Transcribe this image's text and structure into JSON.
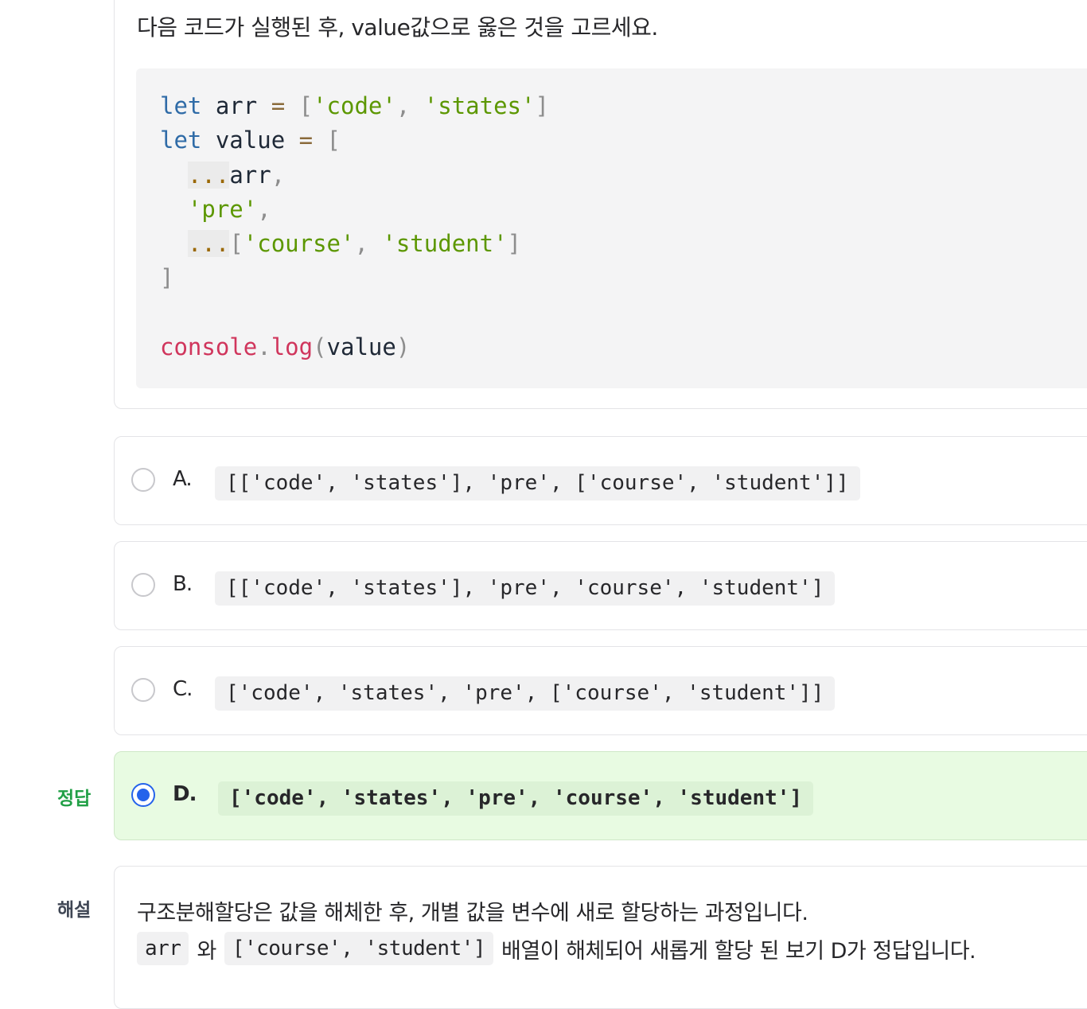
{
  "question": {
    "text": "다음 코드가 실행된 후, value값으로 옳은 것을 고르세요.",
    "code": {
      "line1": {
        "kw": "let",
        "name": " arr ",
        "op": "=",
        "open": " [",
        "s1": "'code'",
        "comma1": ", ",
        "s2": "'states'",
        "close": "]"
      },
      "line2": {
        "kw": "let",
        "name": " value ",
        "op": "=",
        "open": " ["
      },
      "line3": {
        "spread": "...",
        "name": "arr",
        "comma": ","
      },
      "line4": {
        "str": "'pre'",
        "comma": ","
      },
      "line5": {
        "spread": "...",
        "open": "[",
        "s1": "'course'",
        "comma1": ", ",
        "s2": "'student'",
        "close": "]"
      },
      "line6": {
        "close": "]"
      },
      "line8": {
        "obj": "console",
        "dot": ".",
        "fn": "log",
        "open": "(",
        "arg": "value",
        "close": ")"
      }
    }
  },
  "options": [
    {
      "letter": "A.",
      "code": "[['code', 'states'], 'pre', ['course', 'student']]",
      "selected": false
    },
    {
      "letter": "B.",
      "code": "[['code', 'states'], 'pre', 'course', 'student']",
      "selected": false
    },
    {
      "letter": "C.",
      "code": "['code', 'states', 'pre', ['course', 'student']]",
      "selected": false
    },
    {
      "letter": "D.",
      "code": "['code', 'states', 'pre', 'course', 'student']",
      "selected": true
    }
  ],
  "labels": {
    "answer": "정답",
    "explanation": "해설"
  },
  "explanation": {
    "line1": "구조분해할당은 값을 해체한 후, 개별 값을 변수에 새로 할당하는 과정입니다.",
    "code1": "arr",
    "text1": "와",
    "code2": "['course', 'student']",
    "text2": "배열이 해체되어 새롭게 할당 된 보기 D가 정답입니다."
  },
  "colors": {
    "correct_bg": "#e8fbe2",
    "answer_label": "#22a047",
    "radio_selected": "#2563eb",
    "keyword": "#2f6ba7",
    "string": "#5c9700",
    "function": "#d0355c"
  }
}
